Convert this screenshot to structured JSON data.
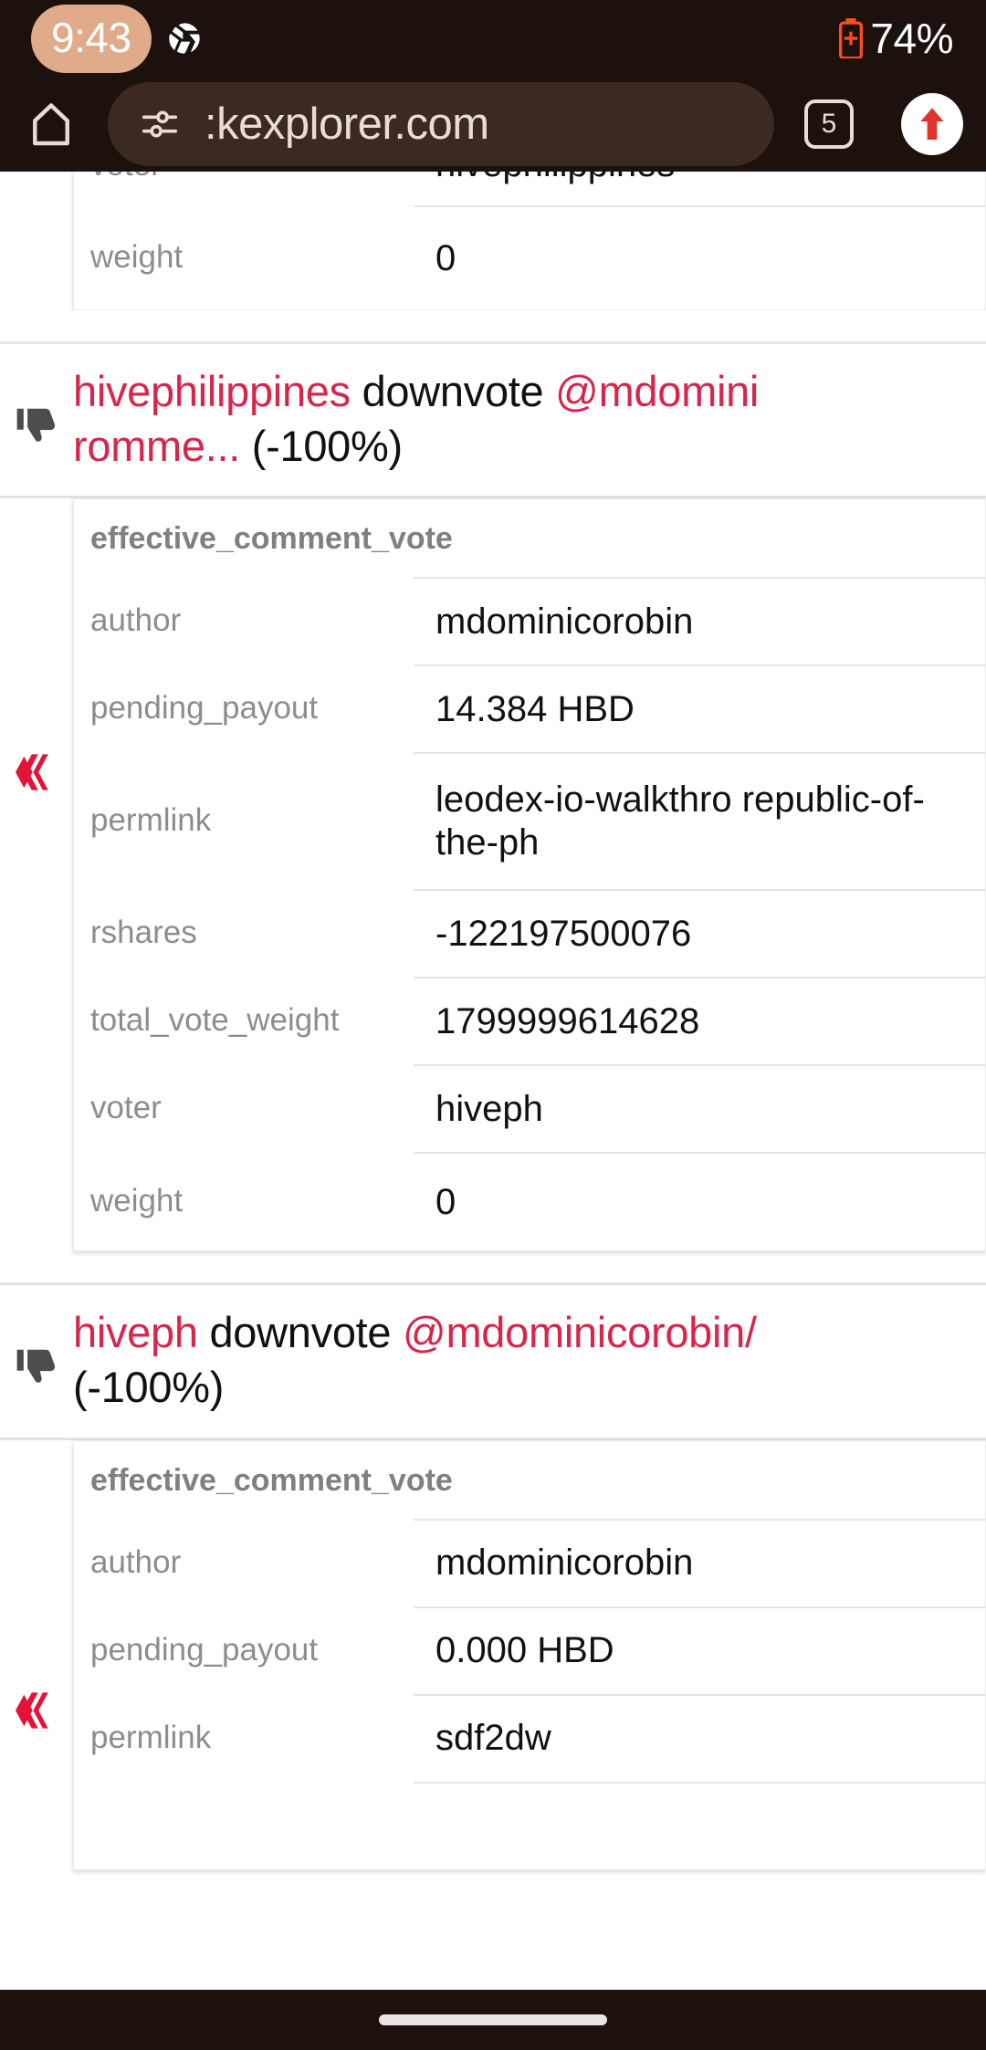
{
  "status_bar": {
    "clock": "9:43",
    "battery_percent": "74%",
    "shutter_icon": "shutter-icon",
    "battery_icon": "battery-icon"
  },
  "browser": {
    "home_icon": "home-icon",
    "permission_icon": "site-permission-icon",
    "url": ":kexplorer.com",
    "tab_count": "5",
    "page_action_icon": "upload-arrow-icon"
  },
  "page": {
    "partial_top_card": {
      "rows": [
        {
          "key": "voter",
          "value": "hivephilippines"
        },
        {
          "key": "weight",
          "value": "0"
        }
      ]
    },
    "operations": [
      {
        "icon": "thumbs-down-icon",
        "header": {
          "voter": "hivephilippines",
          "action": "downvote",
          "target": "@mdomini",
          "target_tail": "romme...",
          "percent": "(-100%)"
        },
        "badge": "hive-logo-icon",
        "card": {
          "title": "effective_comment_vote",
          "rows": [
            {
              "key": "author",
              "value": "mdominicorobin"
            },
            {
              "key": "pending_payout",
              "value": "14.384 HBD"
            },
            {
              "key": "permlink",
              "value": "leodex-io-walkthro\nrepublic-of-the-ph"
            },
            {
              "key": "rshares",
              "value": "-122197500076"
            },
            {
              "key": "total_vote_weight",
              "value": "1799999614628"
            },
            {
              "key": "voter",
              "value": "hiveph"
            },
            {
              "key": "weight",
              "value": "0"
            }
          ]
        }
      },
      {
        "icon": "thumbs-down-icon",
        "header": {
          "voter": "hiveph",
          "action": "downvote",
          "target": "@mdominicorobin/",
          "target_tail": "",
          "percent": "(-100%)"
        },
        "badge": "hive-logo-icon",
        "card": {
          "title": "effective_comment_vote",
          "rows": [
            {
              "key": "author",
              "value": "mdominicorobin"
            },
            {
              "key": "pending_payout",
              "value": "0.000 HBD"
            },
            {
              "key": "permlink",
              "value": "sdf2dw"
            }
          ]
        }
      }
    ]
  },
  "colors": {
    "chrome_bg": "#1c110c",
    "url_bar_bg": "#3a2a22",
    "accent_red": "#d6264c",
    "hive_red": "#e31337",
    "clock_pill": "#e0ab8b",
    "battery_orange": "#ff4d1c",
    "key_gray": "#8d8d8d"
  },
  "bottom_nav": {
    "pill": "home-gesture-pill"
  }
}
